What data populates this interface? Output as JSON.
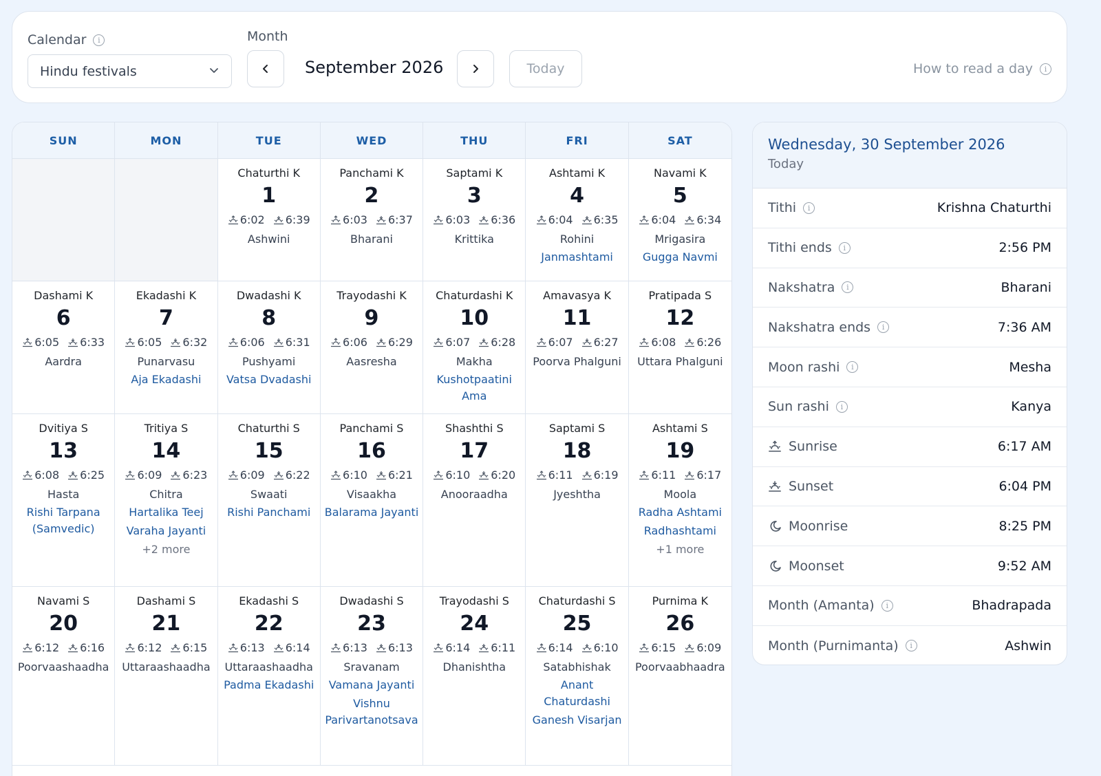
{
  "toolbar": {
    "calendar_label": "Calendar",
    "calendar_value": "Hindu festivals",
    "month_label": "Month",
    "month_title": "September 2026",
    "today_label": "Today",
    "howto_label": "How to read a day"
  },
  "weekdays": [
    "SUN",
    "MON",
    "TUE",
    "WED",
    "THU",
    "FRI",
    "SAT"
  ],
  "days": [
    {
      "tithi": "Chaturthi K",
      "num": "1",
      "rise": "6:02",
      "set": "6:39",
      "nak": "Ashwini",
      "fest": []
    },
    {
      "tithi": "Panchami K",
      "num": "2",
      "rise": "6:03",
      "set": "6:37",
      "nak": "Bharani",
      "fest": []
    },
    {
      "tithi": "Saptami K",
      "num": "3",
      "rise": "6:03",
      "set": "6:36",
      "nak": "Krittika",
      "fest": []
    },
    {
      "tithi": "Ashtami K",
      "num": "4",
      "rise": "6:04",
      "set": "6:35",
      "nak": "Rohini",
      "fest": [
        "Janmashtami"
      ]
    },
    {
      "tithi": "Navami K",
      "num": "5",
      "rise": "6:04",
      "set": "6:34",
      "nak": "Mrigasira",
      "fest": [
        "Gugga Navmi"
      ]
    },
    {
      "tithi": "Dashami K",
      "num": "6",
      "rise": "6:05",
      "set": "6:33",
      "nak": "Aardra",
      "fest": []
    },
    {
      "tithi": "Ekadashi K",
      "num": "7",
      "rise": "6:05",
      "set": "6:32",
      "nak": "Punarvasu",
      "fest": [
        "Aja Ekadashi"
      ]
    },
    {
      "tithi": "Dwadashi K",
      "num": "8",
      "rise": "6:06",
      "set": "6:31",
      "nak": "Pushyami",
      "fest": [
        "Vatsa Dvadashi"
      ]
    },
    {
      "tithi": "Trayodashi K",
      "num": "9",
      "rise": "6:06",
      "set": "6:29",
      "nak": "Aasresha",
      "fest": []
    },
    {
      "tithi": "Chaturdashi K",
      "num": "10",
      "rise": "6:07",
      "set": "6:28",
      "nak": "Makha",
      "fest": [
        "Kushotpaatini Ama"
      ]
    },
    {
      "tithi": "Amavasya K",
      "num": "11",
      "rise": "6:07",
      "set": "6:27",
      "nak": "Poorva Phalguni",
      "fest": []
    },
    {
      "tithi": "Pratipada S",
      "num": "12",
      "rise": "6:08",
      "set": "6:26",
      "nak": "Uttara Phalguni",
      "fest": []
    },
    {
      "tithi": "Dvitiya S",
      "num": "13",
      "rise": "6:08",
      "set": "6:25",
      "nak": "Hasta",
      "fest": [
        "Rishi Tarpana (Samvedic)"
      ]
    },
    {
      "tithi": "Tritiya S",
      "num": "14",
      "rise": "6:09",
      "set": "6:23",
      "nak": "Chitra",
      "fest": [
        "Hartalika Teej",
        "Varaha Jayanti"
      ],
      "more": "+2 more"
    },
    {
      "tithi": "Chaturthi S",
      "num": "15",
      "rise": "6:09",
      "set": "6:22",
      "nak": "Swaati",
      "fest": [
        "Rishi Panchami"
      ]
    },
    {
      "tithi": "Panchami S",
      "num": "16",
      "rise": "6:10",
      "set": "6:21",
      "nak": "Visaakha",
      "fest": [
        "Balarama Jayanti"
      ]
    },
    {
      "tithi": "Shashthi S",
      "num": "17",
      "rise": "6:10",
      "set": "6:20",
      "nak": "Anooraadha",
      "fest": []
    },
    {
      "tithi": "Saptami S",
      "num": "18",
      "rise": "6:11",
      "set": "6:19",
      "nak": "Jyeshtha",
      "fest": []
    },
    {
      "tithi": "Ashtami S",
      "num": "19",
      "rise": "6:11",
      "set": "6:17",
      "nak": "Moola",
      "fest": [
        "Radha Ashtami",
        "Radhashtami"
      ],
      "more": "+1 more"
    },
    {
      "tithi": "Navami S",
      "num": "20",
      "rise": "6:12",
      "set": "6:16",
      "nak": "Poorvaashaadha",
      "fest": []
    },
    {
      "tithi": "Dashami S",
      "num": "21",
      "rise": "6:12",
      "set": "6:15",
      "nak": "Uttaraashaadha",
      "fest": []
    },
    {
      "tithi": "Ekadashi S",
      "num": "22",
      "rise": "6:13",
      "set": "6:14",
      "nak": "Uttaraashaadha",
      "fest": [
        "Padma Ekadashi"
      ]
    },
    {
      "tithi": "Dwadashi S",
      "num": "23",
      "rise": "6:13",
      "set": "6:13",
      "nak": "Sravanam",
      "fest": [
        "Vamana Jayanti",
        "Vishnu Parivartanotsava"
      ]
    },
    {
      "tithi": "Trayodashi S",
      "num": "24",
      "rise": "6:14",
      "set": "6:11",
      "nak": "Dhanishtha",
      "fest": []
    },
    {
      "tithi": "Chaturdashi S",
      "num": "25",
      "rise": "6:14",
      "set": "6:10",
      "nak": "Satabhishak",
      "fest": [
        "Anant Chaturdashi",
        "Ganesh Visarjan"
      ]
    },
    {
      "tithi": "Purnima K",
      "num": "26",
      "rise": "6:15",
      "set": "6:09",
      "nak": "Poorvaabhaadra",
      "fest": []
    }
  ],
  "panel": {
    "date": "Wednesday, 30 September 2026",
    "sub": "Today",
    "rows": [
      {
        "label": "Tithi",
        "value": "Krishna Chaturthi",
        "icon": "info-icon"
      },
      {
        "label": "Tithi ends",
        "value": "2:56 PM",
        "icon": "info-icon"
      },
      {
        "label": "Nakshatra",
        "value": "Bharani",
        "icon": "info-icon"
      },
      {
        "label": "Nakshatra ends",
        "value": "7:36 AM",
        "icon": "info-icon"
      },
      {
        "label": "Moon rashi",
        "value": "Mesha",
        "icon": "info-icon"
      },
      {
        "label": "Sun rashi",
        "value": "Kanya",
        "icon": "info-icon"
      },
      {
        "label": "Sunrise",
        "value": "6:17 AM",
        "icon": "sunrise-icon"
      },
      {
        "label": "Sunset",
        "value": "6:04 PM",
        "icon": "sunset-icon"
      },
      {
        "label": "Moonrise",
        "value": "8:25 PM",
        "icon": "moon-icon"
      },
      {
        "label": "Moonset",
        "value": "9:52 AM",
        "icon": "moon-icon"
      },
      {
        "label": "Month (Amanta)",
        "value": "Bhadrapada",
        "icon": "info-icon"
      },
      {
        "label": "Month (Purnimanta)",
        "value": "Ashwin",
        "icon": "info-icon"
      }
    ]
  },
  "colors": {
    "accent": "#1d5ea6",
    "festival": "#1e5aa0",
    "background": "#edf4fd"
  }
}
